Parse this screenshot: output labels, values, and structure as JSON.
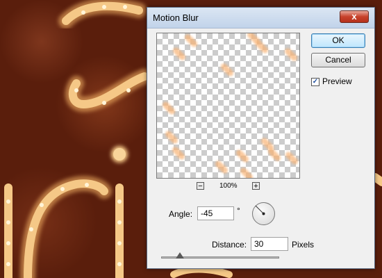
{
  "dialog": {
    "title": "Motion Blur",
    "close_label": "x"
  },
  "buttons": {
    "ok_label": "OK",
    "cancel_label": "Cancel"
  },
  "preview": {
    "label": "Preview",
    "checked": true,
    "zoom_level": "100%",
    "zoom_out_label": "−",
    "zoom_in_label": "+"
  },
  "angle": {
    "label": "Angle:",
    "value": "-45",
    "unit": "°"
  },
  "distance": {
    "label": "Distance:",
    "value": "30",
    "unit": "Pixels"
  },
  "slider": {
    "value": 30
  },
  "icons": {
    "close": "close-icon",
    "checkbox": "checkmark-icon",
    "dial": "angle-dial-icon"
  },
  "colors": {
    "title_bar": "#c1d3ea",
    "close_button": "#c7422b",
    "dialog_bg": "#f0f0f0",
    "background": "#5a1e0c",
    "neon_glow": "#f8b273"
  }
}
